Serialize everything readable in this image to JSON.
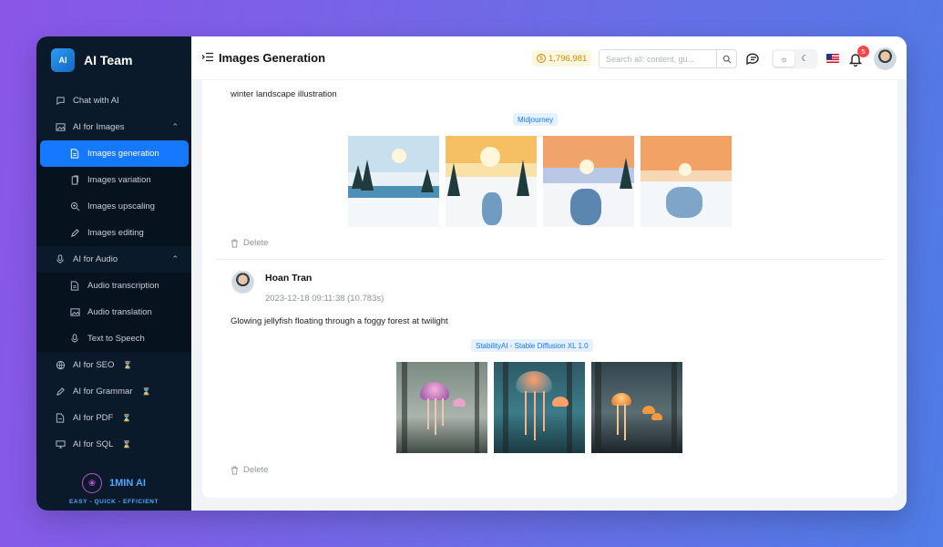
{
  "app": {
    "brand_name": "AI Team",
    "brand_logo_text": "AI",
    "page_title": "Images Generation"
  },
  "sidebar": {
    "items": [
      {
        "label": "Chat with AI",
        "icon": "chat-icon"
      },
      {
        "label": "AI for Images",
        "icon": "image-icon",
        "expanded": true,
        "children": [
          {
            "label": "Images generation",
            "icon": "document-icon",
            "active": true
          },
          {
            "label": "Images variation",
            "icon": "copy-icon"
          },
          {
            "label": "Images upscaling",
            "icon": "zoom-icon"
          },
          {
            "label": "Images editing",
            "icon": "pencil-icon"
          }
        ]
      },
      {
        "label": "AI for Audio",
        "icon": "microphone-icon",
        "expanded": true,
        "children": [
          {
            "label": "Audio transcription",
            "icon": "document-icon"
          },
          {
            "label": "Audio translation",
            "icon": "image-icon"
          },
          {
            "label": "Text to Speech",
            "icon": "microphone-icon"
          }
        ]
      },
      {
        "label": "AI for SEO",
        "icon": "globe-icon",
        "pending": true
      },
      {
        "label": "AI for Grammar",
        "icon": "pencil-icon",
        "pending": true
      },
      {
        "label": "AI for PDF",
        "icon": "pdf-icon",
        "pending": true
      },
      {
        "label": "AI for SQL",
        "icon": "monitor-icon",
        "pending": true
      }
    ],
    "promo": {
      "name": "1MIN AI",
      "tagline": "EASY - QUICK - EFFICIENT"
    }
  },
  "topbar": {
    "credits": "1,796,981",
    "search_placeholder": "Search all: content, gu...",
    "notification_count": "5",
    "language_flag": "us-flag"
  },
  "generations": [
    {
      "prompt": "winter landscape illustration",
      "model": "Midjourney",
      "images": 4,
      "delete_label": "Delete"
    },
    {
      "user": "Hoan Tran",
      "timestamp": "2023-12-18 09:11:38 (10.783s)",
      "prompt": "Glowing jellyfish floating through a foggy forest at twilight",
      "model": "StabilityAI - Stable Diffusion XL 1.0",
      "images": 3,
      "delete_label": "Delete"
    }
  ],
  "colors": {
    "sidebar_bg": "#0b1a2a",
    "accent": "#1677ff",
    "credits": "#c98a00",
    "badge": "#f5484a"
  }
}
